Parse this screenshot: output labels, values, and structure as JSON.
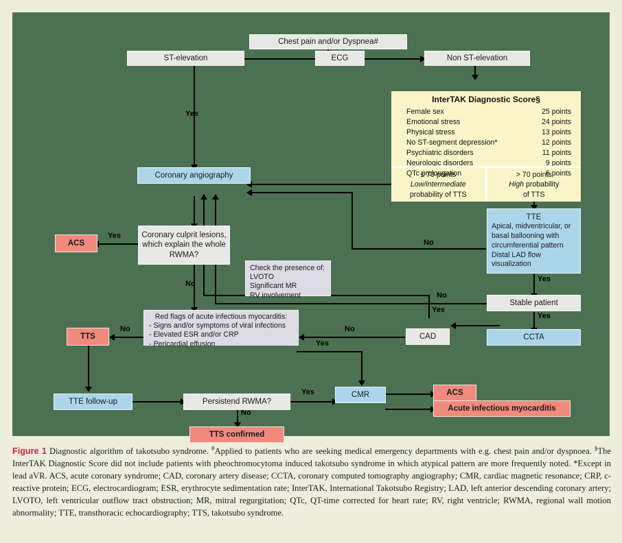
{
  "figure": {
    "label": "Figure 1",
    "caption_main": "Diagnostic algorithm of takotsubo syndrome.",
    "note_hash": "Applied to patients who are seeking medical emergency departments with e.g. chest pain and/or dyspnoea.",
    "note_section": "The InterTAK Diagnostic Score did not include patients with pheochromocytoma induced takotsubo syndrome in which atypical pattern are more frequently noted.",
    "note_star": "*Except in lead aVR.",
    "abbreviations": "ACS, acute coronary syndrome; CAD, coronary artery disease; CCTA, coronary computed tomography angiography; CMR, cardiac magnetic resonance; CRP, c-reactive protein; ECG, electrocardiogram; ESR, erythrocyte sedimentation rate; InterTAK, International Takotsubo Registry; LAD, left anterior descending coronary artery; LVOTO, left ventricular outflow tract obstruction; MR, mitral regurgitation; QTc, QT-time corrected for heart rate; RV, right ventricle; RWMA, regional wall motion abnormality; TTE, transthoracic echocardiography; TTS, takotsubo syndrome."
  },
  "colors": {
    "panel": "#4c7152",
    "page": "#edeedd",
    "grey_node": "#e8e8e6",
    "blue_node": "#abd6ea",
    "red_node": "#ef8a7d",
    "lavender_node": "#dcdae4",
    "cream_node": "#faf4c8",
    "figure_label": "#cf2340"
  },
  "nodes": {
    "chest_pain": "Chest pain and/or Dyspnea#",
    "st_elevation": "ST-elevation",
    "ecg": "ECG",
    "non_st_elevation": "Non ST-elevation",
    "coronary_angiography": "Coronary angiography",
    "acs_top": "ACS",
    "culprit_lesions": "Coronary culprit lesions, which explain the whole RWMA?",
    "check_presence_title": "Check the presence of:",
    "check_presence_items": [
      "LVOTO",
      "Significant MR",
      "RV involvement"
    ],
    "tte_title": "TTE",
    "tte_body": "Apical, midventricular, or basal ballooning with circumferential pattern Distal LAD flow visualization",
    "stable_patient": "Stable patient",
    "ccta": "CCTA",
    "cad": "CAD",
    "tts": "TTS",
    "red_flags_title": "Red flags of acute infectious myocarditis:",
    "red_flags_items": [
      "- Signs and/or symptoms of viral infections",
      "- Elevated ESR and/or CRP",
      "- Pericardial effusion"
    ],
    "tte_followup": "TTE follow-up",
    "persistend_rwma": "Persistend RWMA?",
    "tts_confirmed": "TTS confirmed",
    "cmr": "CMR",
    "acs_bottom": "ACS",
    "acute_myocarditis": "Acute infectious myocarditis"
  },
  "intertak": {
    "title": "InterTAK Diagnostic Score§",
    "criteria": [
      {
        "name": "Female sex",
        "points": "25 points"
      },
      {
        "name": "Emotional stress",
        "points": "24 points"
      },
      {
        "name": "Physical stress",
        "points": "13 points"
      },
      {
        "name": "No ST-segment depression*",
        "points": "12 points"
      },
      {
        "name": "Psychiatric disorders",
        "points": "11 points"
      },
      {
        "name": "Neurologic disorders",
        "points": "9 points"
      },
      {
        "name": "QTc prolongation",
        "points": "6 points"
      }
    ],
    "low": {
      "threshold": "≤ 70 points",
      "level": "Low/intermediate",
      "tail": "probability of TTS"
    },
    "high": {
      "threshold": "> 70 points",
      "level": "High",
      "tail": "probability",
      "tail2": "of TTS"
    }
  },
  "edge_labels": {
    "yes_st_to_angio": "Yes",
    "yes_culprit_acs": "Yes",
    "no_culprit": "No",
    "no_tte_to_angio": "No",
    "yes_tte_stable": "Yes",
    "yes_stable_ccta": "Yes",
    "no_stable_redflags": "No",
    "yes_cad_angio": "Yes",
    "no_cad_redflags": "No",
    "no_redflags_tts": "No",
    "yes_redflags_cmr": "Yes",
    "yes_rwma_cmr": "Yes",
    "no_rwma_confirmed": "No"
  }
}
